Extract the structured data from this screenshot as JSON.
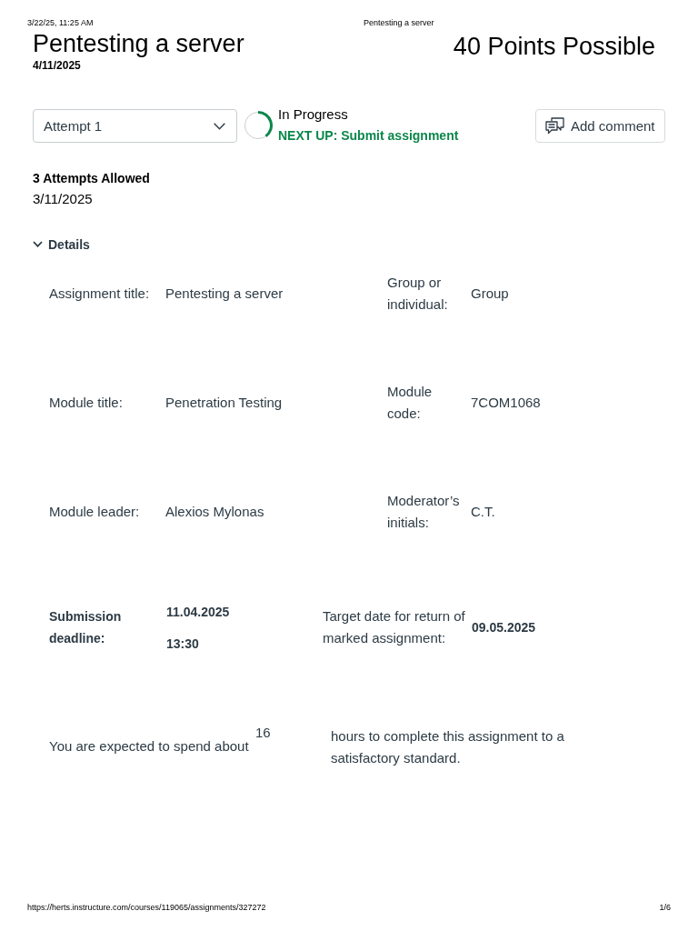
{
  "print_header": {
    "datetime": "3/22/25, 11:25 AM",
    "page_title": "Pentesting a server"
  },
  "assignment": {
    "title": "Pentesting a server",
    "due_date": "4/11/2025",
    "points": "40 Points Possible"
  },
  "attempt_bar": {
    "attempt_select": {
      "value": "Attempt 1"
    },
    "status": {
      "label": "In Progress",
      "next_step": "NEXT UP: Submit assignment",
      "level": 0.4
    },
    "add_comment_button": "Add comment"
  },
  "attempts": {
    "allowed": "3 Attempts Allowed",
    "date": "3/11/2025"
  },
  "details": {
    "label": "Details",
    "expanded": true,
    "rows": [
      {
        "kind": "pair",
        "fields": [
          {
            "label": "Assignment title:",
            "values": [
              "Pentesting a server"
            ]
          },
          {
            "label": "Group or individual:",
            "values": [
              "Group"
            ]
          }
        ]
      },
      {
        "kind": "pair",
        "fields": [
          {
            "label": "Module title:",
            "values": [
              "Penetration Testing"
            ]
          },
          {
            "label": "Module code:",
            "values": [
              "7COM1068"
            ]
          }
        ]
      },
      {
        "kind": "pair",
        "fields": [
          {
            "label": "Module leader:",
            "values": [
              "Alexios Mylonas"
            ]
          },
          {
            "label": "Moderator’s initials:",
            "values": [
              "C.T."
            ]
          }
        ]
      },
      {
        "kind": "deadline",
        "fields": [
          {
            "label": "Submission deadline:",
            "values": [
              "11.04.2025",
              "13:30"
            ]
          },
          {
            "label": "Target date for return of marked assignment:",
            "values": [
              "09.05.2025"
            ]
          }
        ]
      },
      {
        "kind": "hours",
        "before": "You are expected to spend about",
        "hours": "16",
        "after": "hours to complete this assignment to a satisfactory standard."
      }
    ]
  },
  "print_footer": {
    "url": "https://herts.instructure.com/courses/119065/assignments/327272",
    "page": "1/6"
  }
}
